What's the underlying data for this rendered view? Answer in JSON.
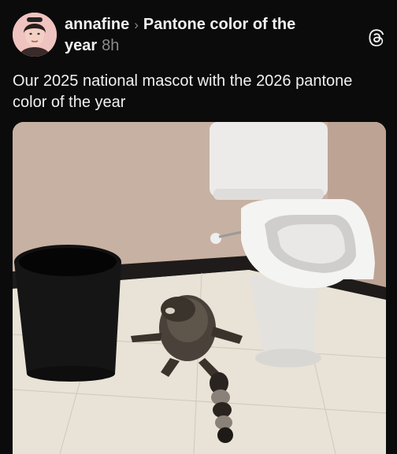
{
  "post": {
    "username": "annafine",
    "topic": "Pantone color of the year",
    "time": "8h",
    "caption": "Our 2025 national mascot with the 2026 pantone color of the year"
  },
  "icons": {
    "topic_separator": "chevron-right-icon",
    "app": "threads-logo-icon"
  },
  "colors": {
    "background": "#0b0b0b",
    "text": "#f2f2f2",
    "muted": "#8a8a8a"
  }
}
